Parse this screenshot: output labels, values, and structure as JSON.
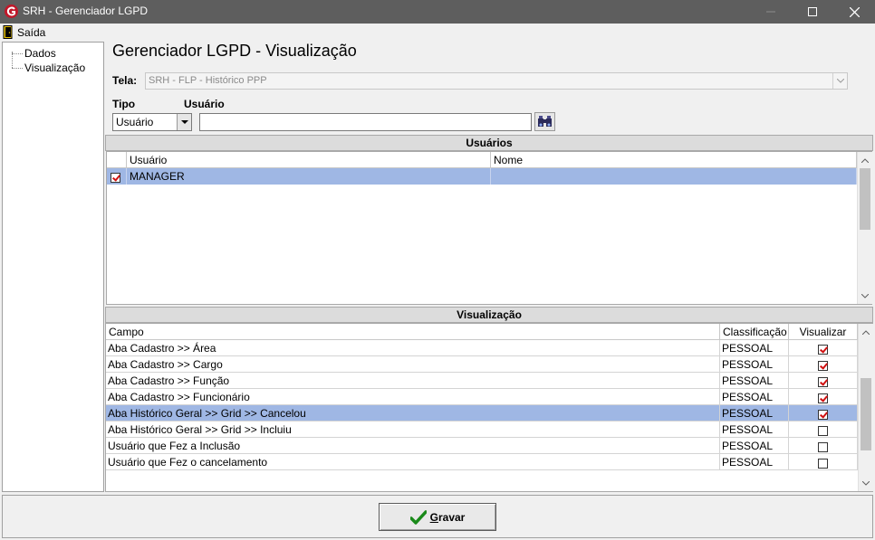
{
  "window": {
    "title": "SRH - Gerenciador LGPD"
  },
  "menu": {
    "exit_label": "Saída"
  },
  "tree": {
    "items": [
      "Dados",
      "Visualização"
    ]
  },
  "page": {
    "title": "Gerenciador LGPD - Visualização"
  },
  "form": {
    "tela_label": "Tela:",
    "tela_value": "SRH - FLP - Histórico PPP",
    "tipo_label": "Tipo",
    "tipo_value": "Usuário",
    "usuario_label": "Usuário",
    "usuario_value": ""
  },
  "users_group": {
    "title": "Usuários",
    "columns": [
      "Usuário",
      "Nome"
    ],
    "rows": [
      {
        "checked": true,
        "usuario": "MANAGER",
        "nome": ""
      }
    ]
  },
  "view_group": {
    "title": "Visualização",
    "columns": [
      "Campo",
      "Classificação",
      "Visualizar"
    ],
    "rows": [
      {
        "campo": "Aba Cadastro >> Área",
        "classificacao": "PESSOAL",
        "visualizar": true
      },
      {
        "campo": "Aba Cadastro >> Cargo",
        "classificacao": "PESSOAL",
        "visualizar": true
      },
      {
        "campo": "Aba Cadastro >> Função",
        "classificacao": "PESSOAL",
        "visualizar": true
      },
      {
        "campo": "Aba Cadastro >> Funcionário",
        "classificacao": "PESSOAL",
        "visualizar": true
      },
      {
        "campo": "Aba Histórico Geral >> Grid >> Cancelou",
        "classificacao": "PESSOAL",
        "visualizar": true,
        "selected": true
      },
      {
        "campo": "Aba Histórico Geral >> Grid >> Incluiu",
        "classificacao": "PESSOAL",
        "visualizar": false
      },
      {
        "campo": "Usuário que Fez a Inclusão",
        "classificacao": "PESSOAL",
        "visualizar": false
      },
      {
        "campo": "Usuário que Fez o cancelamento",
        "classificacao": "PESSOAL",
        "visualizar": false
      }
    ]
  },
  "actions": {
    "save_label_underlined": "G",
    "save_label_rest": "ravar"
  },
  "colors": {
    "titlebar": "#5e5e5e",
    "selection": "#9fb7e4",
    "check": "#d01010",
    "save_icon": "#1a8a1a"
  }
}
